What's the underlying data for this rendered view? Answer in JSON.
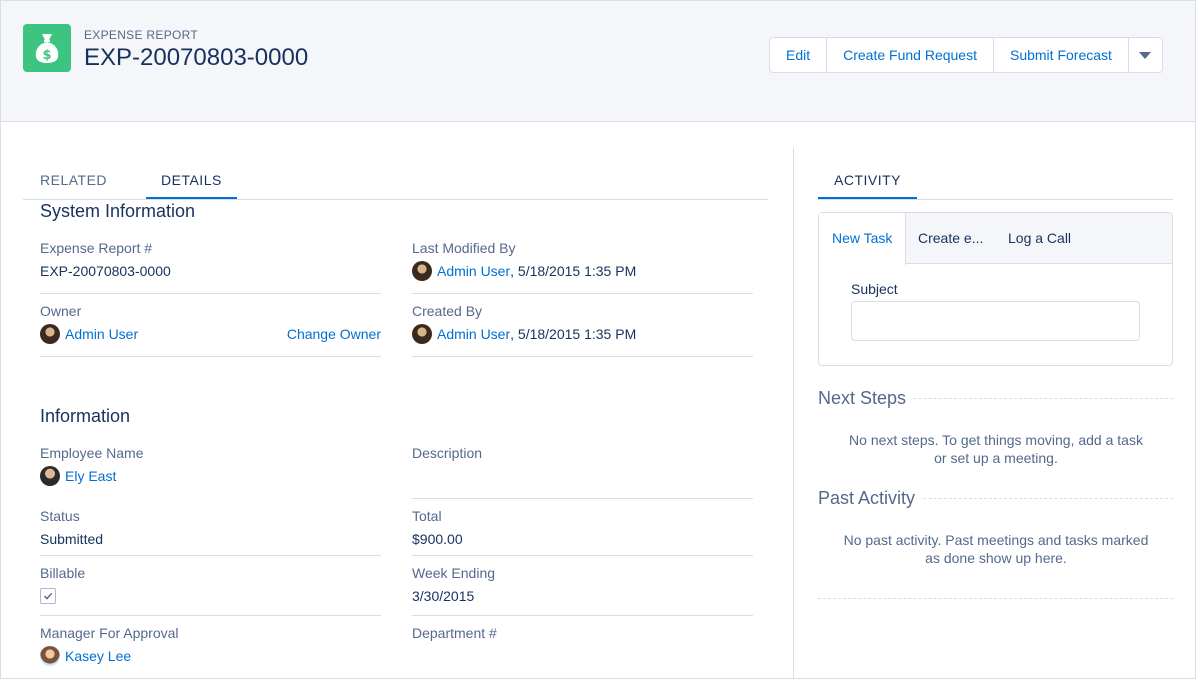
{
  "header": {
    "object_type": "EXPENSE REPORT",
    "record_name": "EXP-20070803-0000",
    "icon": "money-bag-icon",
    "icon_color": "#3cc480",
    "buttons": {
      "edit": "Edit",
      "create_fund_request": "Create Fund Request",
      "submit_forecast": "Submit Forecast"
    }
  },
  "tabs": {
    "related": "RELATED",
    "details": "DETAILS"
  },
  "system_info": {
    "title": "System Information",
    "expense_report_label": "Expense Report #",
    "expense_report_value": "EXP-20070803-0000",
    "last_modified_label": "Last Modified By",
    "last_modified_user": "Admin User",
    "last_modified_date": ", 5/18/2015 1:35 PM",
    "owner_label": "Owner",
    "owner_value": "Admin User",
    "change_owner": "Change Owner",
    "created_by_label": "Created By",
    "created_by_user": "Admin User",
    "created_by_date": ", 5/18/2015 1:35 PM"
  },
  "information": {
    "title": "Information",
    "employee_name_label": "Employee Name",
    "employee_name_value": "Ely East",
    "description_label": "Description",
    "status_label": "Status",
    "status_value": "Submitted",
    "total_label": "Total",
    "total_value": "$900.00",
    "billable_label": "Billable",
    "billable_checked": true,
    "week_ending_label": "Week Ending",
    "week_ending_value": "3/30/2015",
    "manager_label": "Manager For Approval",
    "manager_value": "Kasey Lee",
    "department_label": "Department #"
  },
  "activity": {
    "tab": "ACTIVITY",
    "subtabs": {
      "new_task": "New Task",
      "create_event": "Create e...",
      "log_call": "Log a Call"
    },
    "subject_label": "Subject",
    "subject_value": "",
    "next_steps_title": "Next Steps",
    "next_steps_empty": "No next steps. To get things moving, add a task or set up a meeting.",
    "past_activity_title": "Past Activity",
    "past_activity_empty": "No past activity. Past meetings and tasks marked as done show up here."
  },
  "colors": {
    "link": "#0070d2",
    "text": "#16325c",
    "muted": "#54698d",
    "border": "#d8dde6",
    "header_bg": "#f4f6f9"
  }
}
